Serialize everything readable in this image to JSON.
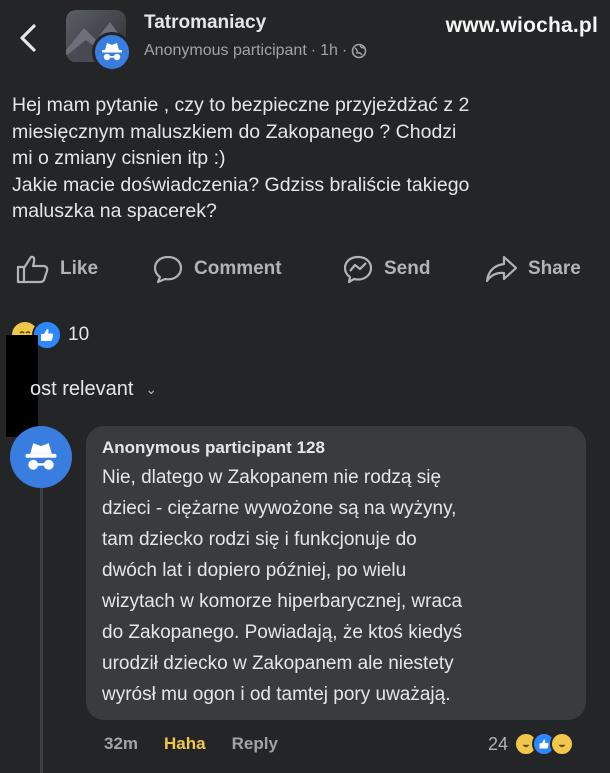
{
  "header": {
    "group_name": "Tatromaniacy",
    "author": "Anonymous participant",
    "separator": "·",
    "time": "1h",
    "privacy_separator": "·"
  },
  "watermark": "www.wiocha.pl",
  "post": {
    "lines": [
      "Hej mam pytanie , czy to bezpieczne przyjeżdżać z 2",
      "miesięcznym  maluszkiem do Zakopanego ? Chodzi",
      "mi o zmiany cisnien itp :)",
      "Jakie macie doświadczenia? Gdziss braliście takiego",
      "maluszka na spacerek?"
    ]
  },
  "actions": {
    "like": "Like",
    "comment": "Comment",
    "send": "Send",
    "share": "Share"
  },
  "reactions": {
    "count": "10"
  },
  "sort": {
    "label": "ost relevant",
    "chevron": "⌄"
  },
  "comment": {
    "author": "Anonymous participant 128",
    "lines": [
      "Nie, dlatego w Zakopanem nie rodzą się",
      "dzieci - ciężarne wywożone są na wyżyny,",
      "tam dziecko rodzi się i funkcjonuje do",
      "dwóch lat i dopiero później, po wielu",
      "wizytach w komorze hiperbarycznej, wraca",
      "do Zakopanego. Powiadają, że ktoś kiedyś",
      "urodził dziecko w Zakopanem ale niestety",
      "wyrósł mu ogon i od tamtej pory uważają."
    ],
    "time": "32m",
    "reaction_label": "Haha",
    "reply": "Reply",
    "reaction_count": "24"
  },
  "colors": {
    "background": "#242526",
    "bubble": "#3a3b3c",
    "anon_blue": "#3a7de0",
    "haha_yellow": "#f0c74b",
    "like_blue": "#2d88ff"
  }
}
